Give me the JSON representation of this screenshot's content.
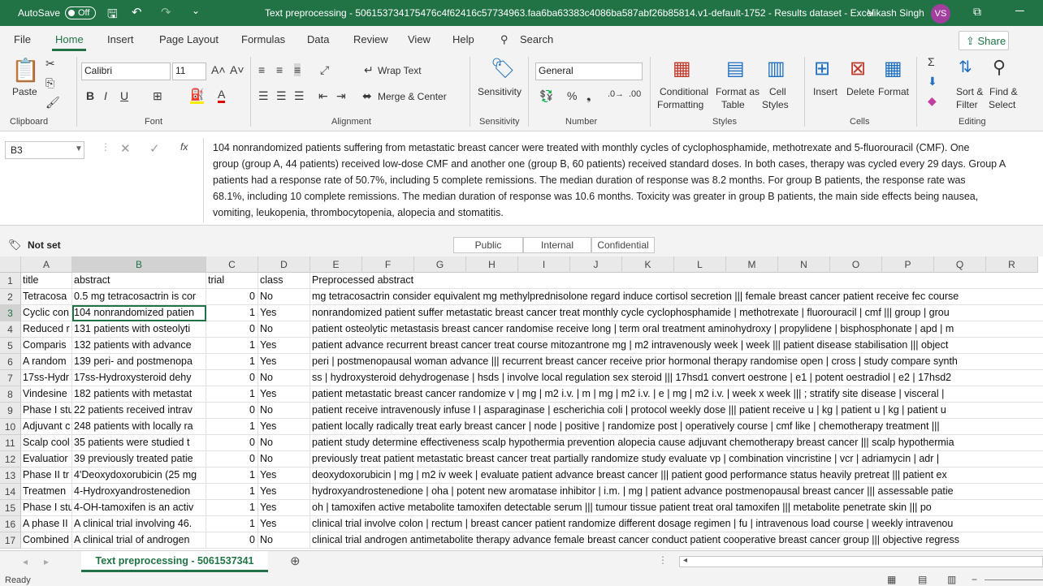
{
  "titlebar": {
    "autosave_label": "AutoSave",
    "autosave_state": "Off",
    "doc_title": "Text preprocessing - 506153734175476c4f62416c57734963.faa6ba63383c4086ba587abf26b85814.v1-default-1752 - Results dataset - Excel",
    "user_name": "Vikash Singh",
    "user_initials": "VS"
  },
  "menu": {
    "items": [
      "File",
      "Home",
      "Insert",
      "Page Layout",
      "Formulas",
      "Data",
      "Review",
      "View",
      "Help"
    ],
    "search": "Search",
    "share": "Share"
  },
  "ribbon": {
    "clipboard": {
      "paste": "Paste",
      "group": "Clipboard"
    },
    "font": {
      "name": "Calibri",
      "size": "11",
      "group": "Font"
    },
    "alignment": {
      "wrap": "Wrap Text",
      "merge": "Merge & Center",
      "group": "Alignment"
    },
    "sensitivity": {
      "label": "Sensitivity",
      "group": "Sensitivity"
    },
    "number": {
      "format": "General",
      "group": "Number"
    },
    "styles": {
      "cond1": "Conditional",
      "cond2": "Formatting",
      "fmt1": "Format as",
      "fmt2": "Table",
      "cell1": "Cell",
      "cell2": "Styles",
      "group": "Styles"
    },
    "cells": {
      "insert": "Insert",
      "delete": "Delete",
      "format": "Format",
      "group": "Cells"
    },
    "editing": {
      "sort1": "Sort &",
      "sort2": "Filter",
      "find1": "Find &",
      "find2": "Select",
      "group": "Editing"
    }
  },
  "formula_bar": {
    "name_box": "B3",
    "fx": "fx",
    "content": "104 nonrandomized patients suffering from metastatic breast cancer were treated with monthly cycles of cyclophosphamide, methotrexate and 5-fluorouracil (CMF). One\ngroup (group A, 44 patients) received low-dose CMF and another one (group B, 60 patients) received standard doses. In both cases, therapy was cycled every 29 days. Group A\npatients had a response rate of 50.7%, including 5 complete remissions. The median duration of response was 8.2 months. For group B patients, the response rate was\n68.1%, including 10 complete remissions. The median duration of response was 10.6 months. Toxicity was greater in group B patients, the main side effects being nausea,\nvomiting, leukopenia, thrombocytopenia, alopecia and stomatitis."
  },
  "labels": {
    "not_set": "Not set",
    "public": "Public",
    "internal": "Internal",
    "confidential": "Confidential"
  },
  "grid": {
    "columns": [
      "A",
      "B",
      "C",
      "D",
      "E",
      "F",
      "G",
      "H",
      "I",
      "J",
      "K",
      "L",
      "M",
      "N",
      "O",
      "P",
      "Q",
      "R"
    ],
    "rows": [
      {
        "n": "1",
        "a": "title",
        "b": "abstract",
        "c": "trial",
        "d": "class",
        "e": "Preprocessed abstract"
      },
      {
        "n": "2",
        "a": "Tetracosa",
        "b": "0.5 mg tetracosactrin is cor",
        "c": "0",
        "d": "No",
        "e": "mg tetracosactrin consider equivalent mg methylprednisolone regard induce cortisol secretion ||| female breast cancer patient receive fec course"
      },
      {
        "n": "3",
        "a": "Cyclic con",
        "b": "104 nonrandomized patien",
        "c": "1",
        "d": "Yes",
        "e": "nonrandomized patient suffer metastatic breast cancer treat monthly cycle cyclophosphamide | methotrexate | fluorouracil | cmf ||| group | grou"
      },
      {
        "n": "4",
        "a": "Reduced r",
        "b": "131 patients with osteolyti",
        "c": "0",
        "d": "No",
        "e": "patient osteolytic metastasis breast cancer randomise receive long | term oral treatment aminohydroxy | propylidene | bisphosphonate | apd | m"
      },
      {
        "n": "5",
        "a": "Comparis",
        "b": "132 patients with advance",
        "c": "1",
        "d": "Yes",
        "e": "patient advance recurrent breast cancer treat course mitozantrone mg | m2 intravenously week | week ||| patient disease stabilisation ||| object"
      },
      {
        "n": "6",
        "a": "A random",
        "b": "139 peri- and postmenopa",
        "c": "1",
        "d": "Yes",
        "e": "peri | postmenopausal woman advance ||| recurrent breast cancer receive prior hormonal therapy randomise open | cross | study compare synth"
      },
      {
        "n": "7",
        "a": "17ss-Hydr",
        "b": "17ss-Hydroxysteroid dehy",
        "c": "0",
        "d": "No",
        "e": "ss | hydroxysteroid dehydrogenase | hsds | involve local regulation sex steroid ||| 17hsd1 convert oestrone | e1 | potent oestradiol | e2 | 17hsd2"
      },
      {
        "n": "8",
        "a": "Vindesine",
        "b": "182 patients with metastat",
        "c": "1",
        "d": "Yes",
        "e": "patient metastatic breast cancer randomize v | mg | m2 i.v. | m | mg | m2 i.v. | e | mg | m2 i.v. | week x week ||| ; stratify site disease | visceral |"
      },
      {
        "n": "9",
        "a": "Phase I stu",
        "b": "22 patients received intrav",
        "c": "0",
        "d": "No",
        "e": "patient receive intravenously infuse l | asparaginase | escherichia coli | protocol weekly dose ||| patient receive u | kg | patient u | kg | patient u"
      },
      {
        "n": "10",
        "a": "Adjuvant c",
        "b": "248 patients with locally ra",
        "c": "1",
        "d": "Yes",
        "e": "patient locally radically treat early breast cancer | node | positive | randomize post | operatively course | cmf like | chemotherapy treatment |||"
      },
      {
        "n": "11",
        "a": "Scalp cool",
        "b": "35 patients were studied t",
        "c": "0",
        "d": "No",
        "e": "patient study determine effectiveness scalp hypothermia prevention alopecia cause adjuvant chemotherapy breast cancer ||| scalp hypothermia"
      },
      {
        "n": "12",
        "a": "Evaluatior",
        "b": "39 previously treated patie",
        "c": "0",
        "d": "No",
        "e": "previously treat patient metastatic breast cancer treat partially randomize study evaluate vp | combination vincristine | vcr | adriamycin | adr |"
      },
      {
        "n": "13",
        "a": "Phase II tr",
        "b": "4'Deoxydoxorubicin (25 mg",
        "c": "1",
        "d": "Yes",
        "e": "deoxydoxorubicin | mg | m2 iv week | evaluate patient advance breast cancer ||| patient good performance status heavily pretreat ||| patient ex"
      },
      {
        "n": "14",
        "a": "Treatmen",
        "b": "4-Hydroxyandrostenedion",
        "c": "1",
        "d": "Yes",
        "e": "hydroxyandrostenedione | oha | potent new aromatase inhibitor | i.m. | mg | patient advance postmenopausal breast cancer ||| assessable patie"
      },
      {
        "n": "15",
        "a": "Phase I stu",
        "b": "4-OH-tamoxifen is an activ",
        "c": "1",
        "d": "Yes",
        "e": "oh | tamoxifen active metabolite tamoxifen detectable serum ||| tumour tissue patient treat oral tamoxifen ||| metabolite penetrate skin ||| po"
      },
      {
        "n": "16",
        "a": "A phase II",
        "b": "A clinical trial involving 46.",
        "c": "1",
        "d": "Yes",
        "e": "clinical trial involve colon | rectum | breast cancer patient randomize different dosage regimen | fu | intravenous load course | weekly intravenou"
      },
      {
        "n": "17",
        "a": "Combined",
        "b": "A clinical trial of androgen",
        "c": "0",
        "d": "No",
        "e": "clinical trial androgen antimetabolite therapy advance female breast cancer conduct patient cooperative breast cancer group ||| objective regress"
      }
    ]
  },
  "sheet": {
    "tab": "Text preprocessing - 5061537341"
  },
  "status": {
    "ready": "Ready"
  }
}
